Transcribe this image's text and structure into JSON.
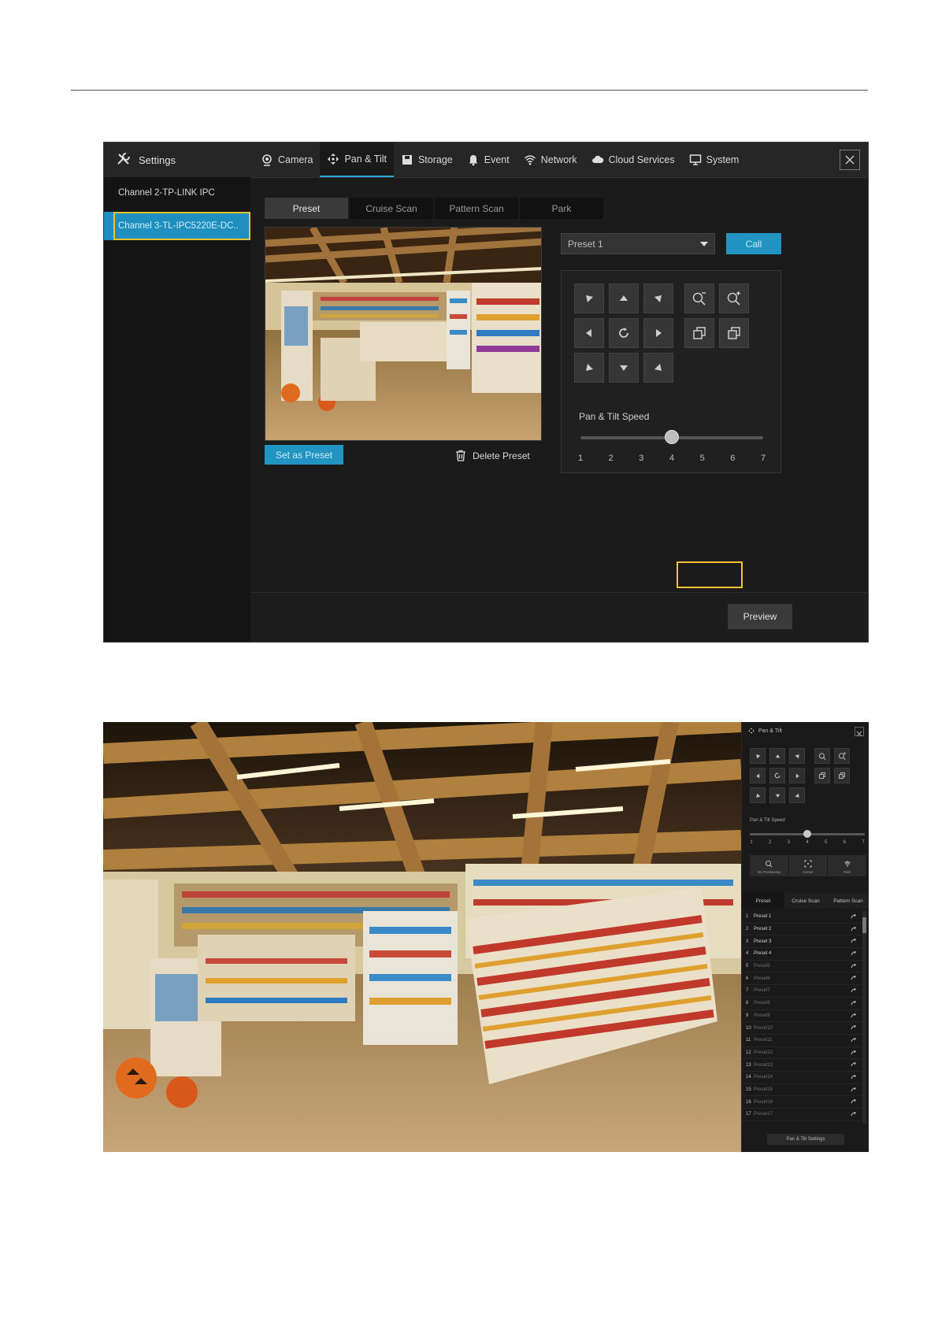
{
  "settings_ui": {
    "brand": {
      "icon": "tools-icon",
      "label": "Settings"
    },
    "tabs": [
      {
        "icon": "camera-icon",
        "label": "Camera"
      },
      {
        "icon": "move-arrows-icon",
        "label": "Pan & Tilt",
        "active": true
      },
      {
        "icon": "storage-icon",
        "label": "Storage"
      },
      {
        "icon": "bell-icon",
        "label": "Event"
      },
      {
        "icon": "wifi-icon",
        "label": "Network"
      },
      {
        "icon": "cloud-icon",
        "label": "Cloud Services"
      },
      {
        "icon": "monitor-icon",
        "label": "System"
      }
    ],
    "channels": [
      {
        "label": "Channel 2-TP-LINK IPC",
        "selected": false
      },
      {
        "label": "Channel 3-TL-IPC5220E-DC..",
        "selected": true
      }
    ],
    "subtabs": [
      {
        "label": "Preset",
        "active": true
      },
      {
        "label": "Cruise Scan",
        "active": false
      },
      {
        "label": "Pattern Scan",
        "active": false
      },
      {
        "label": "Park",
        "active": false
      }
    ],
    "set_preset_label": "Set as Preset",
    "delete_preset_label": "Delete Preset",
    "preset_select_value": "Preset 1",
    "call_label": "Call",
    "speed_label": "Pan & Tilt Speed",
    "speed_ticks": [
      "1",
      "2",
      "3",
      "4",
      "5",
      "6",
      "7"
    ],
    "speed_value": 4,
    "preview_label": "Preview",
    "highlight_color": "#f2c230",
    "accent_color": "#2194c2"
  },
  "live_panel": {
    "title": "Pan & Tilt",
    "speed_label": "Pan & Tilt Speed",
    "speed_ticks": [
      "1",
      "2",
      "3",
      "4",
      "5",
      "6",
      "7"
    ],
    "speed_value": 4,
    "functions": [
      {
        "icon": "3d-positioning-icon",
        "label": "3D Positioning"
      },
      {
        "icon": "center-icon",
        "label": "Center"
      },
      {
        "icon": "park-icon",
        "label": "Park"
      }
    ],
    "tabs": [
      {
        "label": "Preset",
        "active": true
      },
      {
        "label": "Cruise Scan",
        "active": false
      },
      {
        "label": "Pattern Scan",
        "active": false
      }
    ],
    "presets": [
      {
        "num": "1",
        "name": "Preset 1",
        "set": true
      },
      {
        "num": "2",
        "name": "Preset 2",
        "set": true
      },
      {
        "num": "3",
        "name": "Preset 3",
        "set": true
      },
      {
        "num": "4",
        "name": "Preset 4",
        "set": true
      },
      {
        "num": "5",
        "name": "Preset5",
        "set": false
      },
      {
        "num": "6",
        "name": "Preset6",
        "set": false
      },
      {
        "num": "7",
        "name": "Preset7",
        "set": false
      },
      {
        "num": "8",
        "name": "Preset8",
        "set": false
      },
      {
        "num": "9",
        "name": "Preset9",
        "set": false
      },
      {
        "num": "10",
        "name": "Preset10",
        "set": false
      },
      {
        "num": "11",
        "name": "Preset11",
        "set": false
      },
      {
        "num": "12",
        "name": "Preset12",
        "set": false
      },
      {
        "num": "13",
        "name": "Preset13",
        "set": false
      },
      {
        "num": "14",
        "name": "Preset14",
        "set": false
      },
      {
        "num": "15",
        "name": "Preset15",
        "set": false
      },
      {
        "num": "16",
        "name": "Preset16",
        "set": false
      },
      {
        "num": "17",
        "name": "Preset17",
        "set": false
      }
    ],
    "settings_label": "Pan & Tilt Settings"
  }
}
